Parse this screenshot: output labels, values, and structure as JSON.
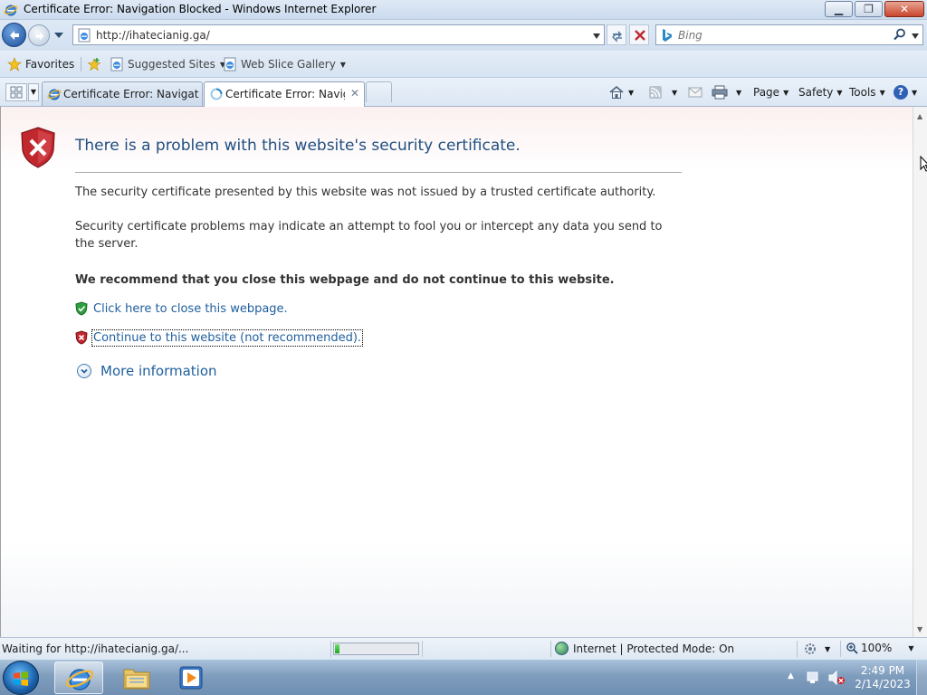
{
  "window": {
    "title": "Certificate Error: Navigation Blocked - Windows Internet Explorer",
    "minimize": "▁",
    "maximize": "❐",
    "close": "✕"
  },
  "address_bar": {
    "url": "http://ihatecianig.ga/",
    "search_placeholder": "Bing"
  },
  "favorites_bar": {
    "favorites_label": "Favorites",
    "items": [
      {
        "label": "Suggested Sites",
        "icon": "ie-page-icon"
      },
      {
        "label": "Web Slice Gallery",
        "icon": "ie-page-icon"
      }
    ]
  },
  "tabs": [
    {
      "label": "Certificate Error: Navigatio...",
      "icon": "ie-logo-icon",
      "active": false
    },
    {
      "label": "Certificate Error: Navig...",
      "icon": "loading-icon",
      "active": true,
      "close": "✕"
    }
  ],
  "command_bar": {
    "page": "Page",
    "safety": "Safety",
    "tools": "Tools",
    "help": "?"
  },
  "page": {
    "title": "There is a problem with this website's security certificate.",
    "para1": "The security certificate presented by this website was not issued by a trusted certificate authority.",
    "para2": "Security certificate problems may indicate an attempt to fool you or intercept any data you send to the server.",
    "recommend": "We recommend that you close this webpage and do not continue to this website.",
    "close_link": "Click here to close this webpage.",
    "continue_link": "Continue to this website (not recommended).",
    "more_info": "More information"
  },
  "status_bar": {
    "text": "Waiting for http://ihatecianig.ga/...",
    "progress": 0.05,
    "zone": "Internet | Protected Mode: On",
    "zoom": "100%"
  },
  "taskbar": {
    "time": "2:49 PM",
    "date": "2/14/2023"
  },
  "colors": {
    "link": "#1f5f9e",
    "title": "#1f4f82",
    "error_red": "#c0282e",
    "safe_green": "#2f9e3f"
  }
}
